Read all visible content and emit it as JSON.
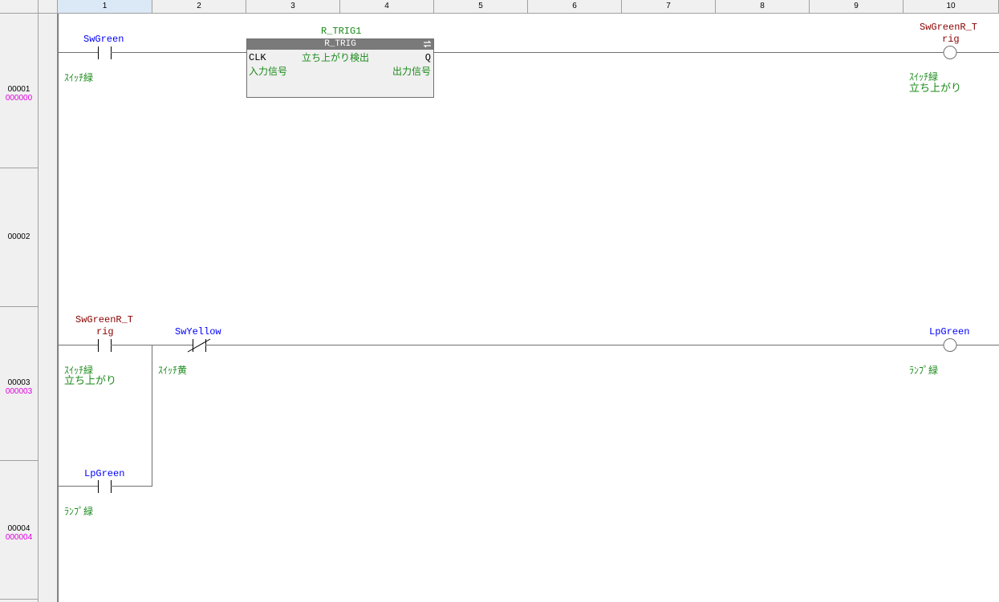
{
  "columns": [
    "1",
    "2",
    "3",
    "4",
    "5",
    "6",
    "7",
    "8",
    "9",
    "10"
  ],
  "rows": [
    {
      "num": "00001",
      "step": "000000"
    },
    {
      "num": "00002",
      "step": ""
    },
    {
      "num": "00003",
      "step": "000003"
    },
    {
      "num": "00004",
      "step": "000004"
    }
  ],
  "rung1": {
    "contact_var": "SwGreen",
    "contact_comment": "ｽｲｯﾁ緑",
    "fb_instance": "R_TRIG1",
    "fb_type": "R_TRIG",
    "fb_in_pin": "CLK",
    "fb_out_pin": "Q",
    "fb_comment": "立ち上がり検出",
    "fb_in_comment": "入力信号",
    "fb_out_comment": "出力信号",
    "coil_var_line1": "SwGreenR_T",
    "coil_var_line2": "rig",
    "coil_comment_line1": "ｽｲｯﾁ緑",
    "coil_comment_line2": "立ち上がり"
  },
  "rung3": {
    "contact_var_line1": "SwGreenR_T",
    "contact_var_line2": "rig",
    "contact_comment_line1": "ｽｲｯﾁ緑",
    "contact_comment_line2": "立ち上がり",
    "nc_contact_var": "SwYellow",
    "nc_contact_comment": "ｽｲｯﾁ黄",
    "coil_var": "LpGreen",
    "coil_comment": "ﾗﾝﾌﾟ緑"
  },
  "rung4": {
    "contact_var": "LpGreen",
    "contact_comment": "ﾗﾝﾌﾟ緑"
  },
  "colors": {
    "variable_local": "#0000ff",
    "variable_global": "#8b0000",
    "comment": "#1a8a1a",
    "step_number": "#e000e0"
  }
}
